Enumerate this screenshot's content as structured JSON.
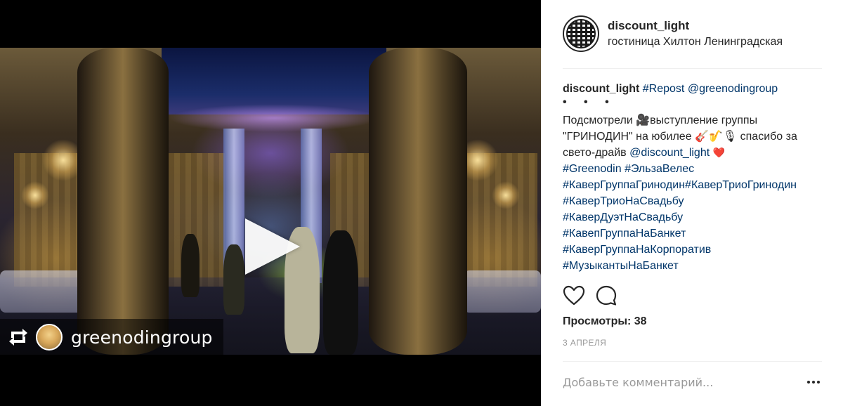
{
  "post": {
    "username": "discount_light",
    "location": "гостиница Хилтон Ленинградская",
    "caption": {
      "username": "discount_light",
      "tags_line1": "#Repost @greenodingroup",
      "dots": "• • •",
      "text1": "Подсмотрели 🎥выступление группы \"ГРИНОДИН\" на юбилее 🎸🎷🎙 спасибо за свето-драйв ",
      "mention": "@discount_light",
      "heart": "❤️",
      "hashtags": [
        "#Greenodin #ЭльзаВелес",
        "#КаверГруппаГринодин#КаверТриоГринодин #КаверТриоНаСвадьбу",
        "#КаверДуэтНаСвадьбу",
        "#КавепГруппаНаБанкет",
        "#КаверГруппаНаКорпоратив",
        "#МузыкантыНаБанкет"
      ]
    },
    "views": "Просмотры: 38",
    "date": "3 АПРЕЛЯ",
    "comment_placeholder": "Добавьте комментарий..."
  },
  "video": {
    "repost_user": "greenodingroup"
  }
}
